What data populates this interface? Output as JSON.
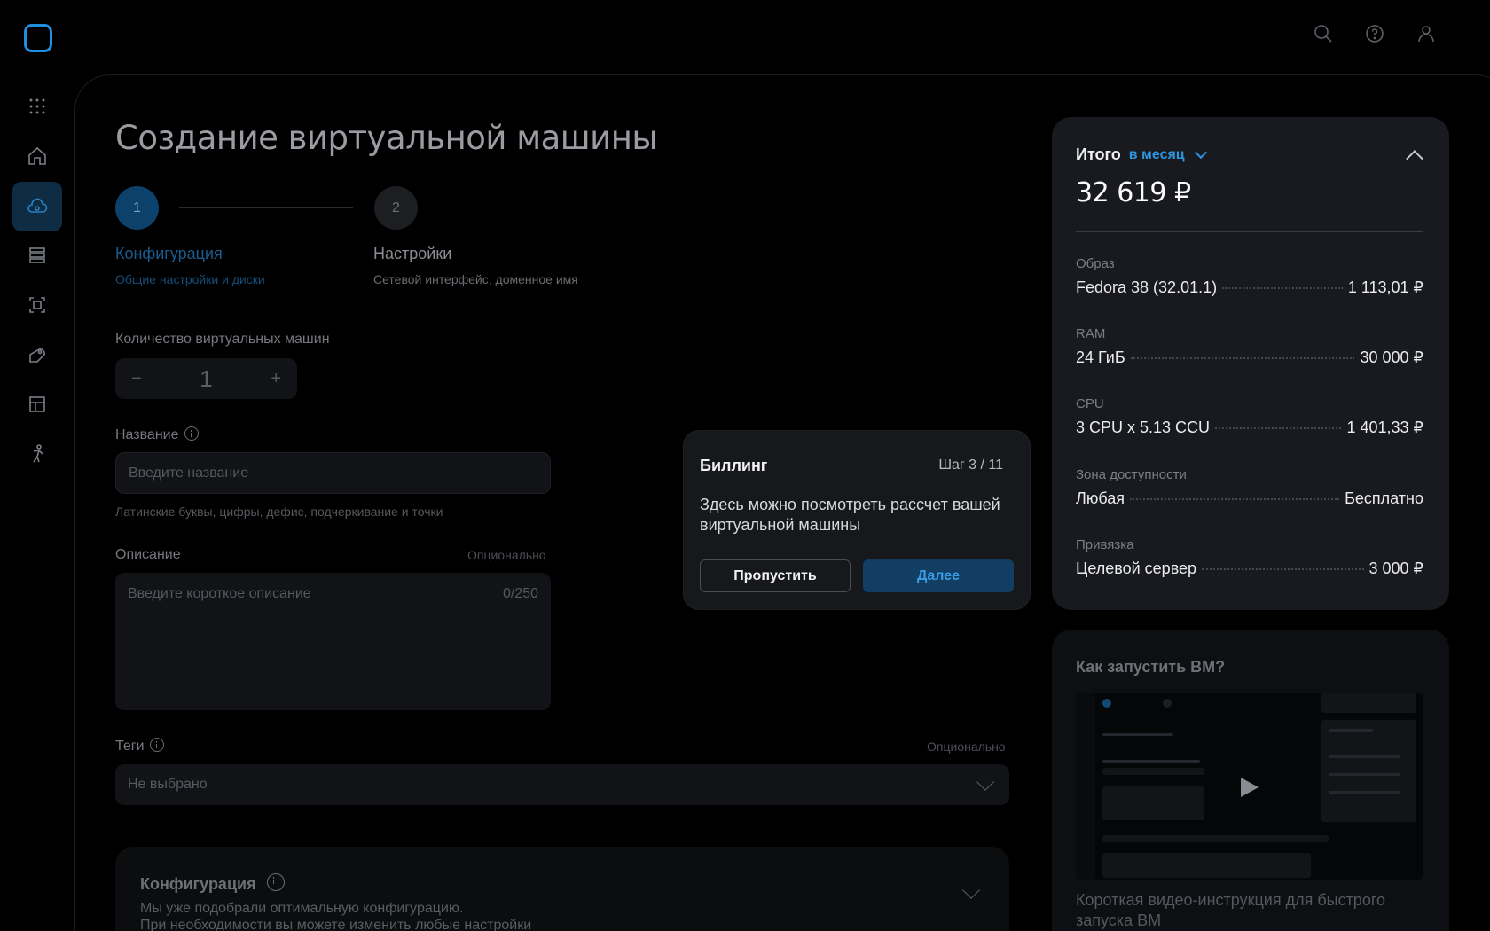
{
  "page": {
    "title": "Создание виртуальной машины"
  },
  "steps": [
    {
      "num": "1",
      "title": "Конфигурация",
      "sub": "Общие настройки и диски"
    },
    {
      "num": "2",
      "title": "Настройки",
      "sub": "Сетевой интерфейс, доменное имя"
    }
  ],
  "form": {
    "count_label": "Количество виртуальных машин",
    "count_value": "1",
    "minus": "−",
    "plus": "+",
    "name_label": "Название",
    "name_placeholder": "Введите название",
    "name_hint": "Латинские буквы, цифры, дефис, подчеркивание и точки",
    "desc_label": "Описание",
    "desc_optional": "Опционально",
    "desc_placeholder": "Введите короткое описание",
    "desc_counter": "0/250",
    "tags_label": "Теги",
    "tags_optional": "Опционально",
    "tags_value": "Не выбрано"
  },
  "config": {
    "title": "Конфигурация",
    "desc1": "Мы уже подобрали оптимальную конфигурацию.",
    "desc2": "При необходимости вы можете изменить любые настройки"
  },
  "summary": {
    "title": "Итого",
    "period": "в месяц",
    "total": "32 619 ₽",
    "rows": [
      {
        "cat": "Образ",
        "name": "Fedora 38 (32.01.1)",
        "price": "1 113,01 ₽"
      },
      {
        "cat": "RAM",
        "name": "24 ГиБ",
        "price": "30 000 ₽"
      },
      {
        "cat": "CPU",
        "name": "3 CPU x 5.13 CCU",
        "price": "1 401,33 ₽"
      },
      {
        "cat": "Зона доступности",
        "name": "Любая",
        "price": "Бесплатно"
      },
      {
        "cat": "Привязка",
        "name": "Целевой сервер",
        "price": "3 000 ₽"
      }
    ]
  },
  "video": {
    "title": "Как запустить ВМ?",
    "desc": "Короткая видео-инструкция для быстрого запуска ВМ"
  },
  "popup": {
    "title": "Биллинг",
    "step": "Шаг 3 / 11",
    "text": "Здесь можно посмотреть рассчет вашей виртуальной машины",
    "skip": "Пропустить",
    "next": "Далее"
  },
  "colors": {
    "accent": "#1f8fe0",
    "background": "#000000",
    "card": "#181a1f"
  }
}
